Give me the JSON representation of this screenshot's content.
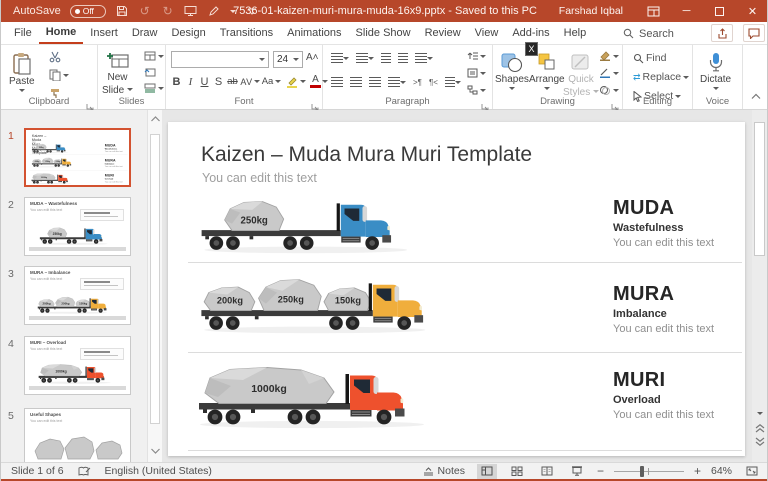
{
  "titlebar": {
    "autosave_label": "AutoSave",
    "autosave_state": "Off",
    "document_title": "7536-01-kaizen-muri-mura-muda-16x9.pptx - Saved to this PC",
    "user_name": "Farshad Iqbal"
  },
  "icons": {
    "undo": "↺",
    "redo": "↻",
    "minimize": "─",
    "close": "✕",
    "zoom_out": "−",
    "zoom_in": "+"
  },
  "ribbon": {
    "tabs": [
      "File",
      "Home",
      "Insert",
      "Draw",
      "Design",
      "Transitions",
      "Animations",
      "Slide Show",
      "Review",
      "View",
      "Add-ins",
      "Help"
    ],
    "active_tab": "Home",
    "addins_keytip": "X",
    "search_label": "Search",
    "groups": {
      "clipboard": {
        "label": "Clipboard",
        "paste": "Paste"
      },
      "slides": {
        "label": "Slides",
        "new_slide_line1": "New",
        "new_slide_line2": "Slide"
      },
      "font": {
        "label": "Font",
        "size": "24",
        "buttons": [
          "B",
          "I",
          "U",
          "S",
          "ab",
          "AV",
          "Aa",
          "A"
        ]
      },
      "paragraph": {
        "label": "Paragraph"
      },
      "drawing": {
        "label": "Drawing",
        "shapes": "Shapes",
        "arrange": "Arrange",
        "quick_styles_line1": "Quick",
        "quick_styles_line2": "Styles"
      },
      "editing": {
        "label": "Editing",
        "find": "Find",
        "replace": "Replace",
        "select": "Select"
      },
      "voice": {
        "label": "Voice",
        "dictate": "Dictate"
      }
    }
  },
  "slide_panel": {
    "slides": [
      {
        "number": "1",
        "selected": true
      },
      {
        "number": "2",
        "title": "MUDA – Wastefulness",
        "subtitle": "You can edit this text"
      },
      {
        "number": "3",
        "title": "MURA – Imbalance",
        "subtitle": "You can edit this text"
      },
      {
        "number": "4",
        "title": "MURI – Overload",
        "subtitle": "You can edit this text"
      },
      {
        "number": "5",
        "title": "Useful Shapes",
        "subtitle": "You can edit this text"
      }
    ]
  },
  "slide": {
    "title": "Kaizen – Muda Mura Muri Template",
    "subtitle": "You can edit this text",
    "rows": [
      {
        "term": "MUDA",
        "meaning": "Wastefulness",
        "note": "You can edit this text",
        "truck_color": "#3A8DC5",
        "rocks": [
          {
            "label": "250kg"
          }
        ]
      },
      {
        "term": "MURA",
        "meaning": "Imbalance",
        "note": "You can edit this text",
        "truck_color": "#F0AE3C",
        "rocks": [
          {
            "label": "200kg"
          },
          {
            "label": "250kg"
          },
          {
            "label": "150kg"
          }
        ]
      },
      {
        "term": "MURI",
        "meaning": "Overload",
        "note": "You can edit this text",
        "truck_color": "#EE512D",
        "rocks": [
          {
            "label": "1000kg"
          }
        ]
      }
    ]
  },
  "status_bar": {
    "slide_indicator": "Slide 1 of 6",
    "language": "English (United States)",
    "notes_label": "Notes",
    "zoom_level": "64%"
  },
  "colors": {
    "titlebar_bg": "#B7472A",
    "tab_accent": "#C43E1C",
    "selected_thumbnail_border": "#D35230",
    "rock_fill": "#C9C9C9",
    "truck_blue": "#3A8DC5",
    "truck_yellow": "#F0AE3C",
    "truck_orange": "#EE512D"
  }
}
